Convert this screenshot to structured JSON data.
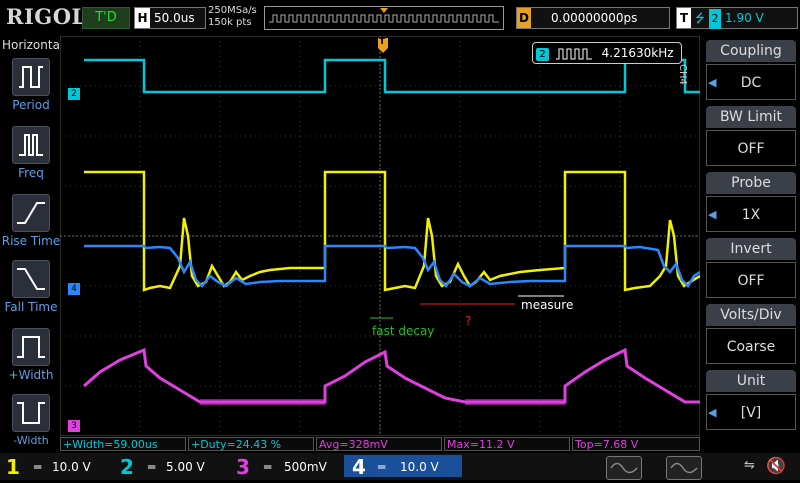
{
  "top": {
    "logo": "RIGOL",
    "trigger_state": "T'D",
    "horizontal_label": "H",
    "timebase": "50.0us",
    "sample_rate": "250MSa/s",
    "memory_depth": "150k pts",
    "delay_label": "D",
    "delay_value": "0.00000000ps",
    "trigger_label": "T",
    "trigger_source": "2",
    "trigger_level": "1.90 V",
    "trigger_marker": "T"
  },
  "left_panel": {
    "title": "Horizontal",
    "items": [
      {
        "label": "Period"
      },
      {
        "label": "Freq"
      },
      {
        "label": "Rise Time"
      },
      {
        "label": "Fall Time"
      },
      {
        "label": "+Width"
      },
      {
        "label": "-Width"
      }
    ]
  },
  "right_panel": {
    "channel_tag": "CH4",
    "menus": [
      {
        "title": "Coupling",
        "value": "DC"
      },
      {
        "title": "BW Limit",
        "value": "OFF"
      },
      {
        "title": "Probe",
        "value": "1X"
      },
      {
        "title": "Invert",
        "value": "OFF"
      },
      {
        "title": "Volts/Div",
        "value": "Coarse"
      },
      {
        "title": "Unit",
        "value": "[V]"
      }
    ]
  },
  "freq_counter": {
    "channel": "2",
    "value": "4.21630kHz"
  },
  "annotations": {
    "fast_decay": "fast decay",
    "question": "?",
    "measure": "measure"
  },
  "channel_markers": {
    "ch2": "2",
    "ch4": "4",
    "ch3": "3"
  },
  "measurements": [
    {
      "text": "+Width=59.00us",
      "color": "#00c8d8"
    },
    {
      "text": "+Duty=24.43 %",
      "color": "#00c8d8"
    },
    {
      "text": "Avg=328mV",
      "color": "#e040e0"
    },
    {
      "text": "Max=11.2 V",
      "color": "#e040e0"
    },
    {
      "text": "Top=7.68 V",
      "color": "#e040e0"
    }
  ],
  "channels": [
    {
      "num": "1",
      "scale": "10.0 V",
      "color": "#f0f000"
    },
    {
      "num": "2",
      "scale": "5.00 V",
      "color": "#00c8d8"
    },
    {
      "num": "3",
      "scale": "500mV",
      "color": "#e040e0"
    },
    {
      "num": "4",
      "scale": "10.0 V",
      "color": "#2a88ff"
    }
  ],
  "colors": {
    "ch1": "#f0f000",
    "ch2": "#00c8d8",
    "ch3": "#e040e0",
    "ch4": "#2a88ff",
    "trigger": "#e8a020",
    "accent": "#5aa0e8"
  }
}
